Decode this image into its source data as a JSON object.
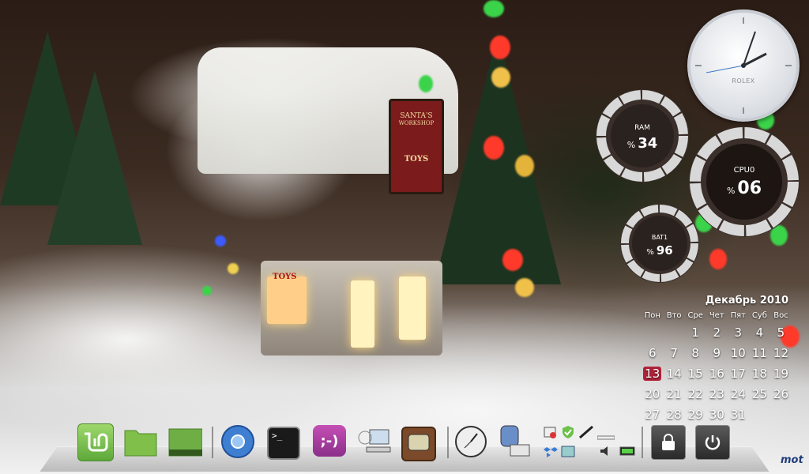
{
  "wallpaper": {
    "sign_line1": "SANTA'S",
    "sign_line2": "WORKSHOP",
    "sign_line3": "TOYS",
    "lower_sign": "TOYS"
  },
  "clock": {
    "brand": "ROLEX"
  },
  "monitors": {
    "ram": {
      "label": "RAM",
      "symbol": "%",
      "value": "34",
      "percent": 34
    },
    "cpu": {
      "label": "CPU0",
      "symbol": "%",
      "value": "06",
      "percent": 6
    },
    "battery": {
      "label": "BAT1",
      "symbol": "%",
      "value": "96",
      "percent": 96
    }
  },
  "calendar": {
    "title": "Декабрь 2010",
    "weekdays": [
      "Пон",
      "Вто",
      "Сре",
      "Чет",
      "Пят",
      "Суб",
      "Вос"
    ],
    "weeks": [
      [
        "",
        "",
        "1",
        "2",
        "3",
        "4",
        "5"
      ],
      [
        "6",
        "7",
        "8",
        "9",
        "10",
        "11",
        "12"
      ],
      [
        "13",
        "14",
        "15",
        "16",
        "17",
        "18",
        "19"
      ],
      [
        "20",
        "21",
        "22",
        "23",
        "24",
        "25",
        "26"
      ],
      [
        "27",
        "28",
        "29",
        "30",
        "31",
        "",
        ""
      ]
    ],
    "today": "13"
  },
  "dock": {
    "items": [
      {
        "name": "mint-menu-icon"
      },
      {
        "name": "folder-icon"
      },
      {
        "name": "folder-desktop-icon"
      },
      {
        "name": "chromium-browser-icon"
      },
      {
        "name": "terminal-icon"
      },
      {
        "name": "pidgin-chat-icon"
      },
      {
        "name": "network-computer-icon"
      },
      {
        "name": "tv-player-icon"
      },
      {
        "name": "clock-app-icon"
      },
      {
        "name": "printer-icon"
      }
    ],
    "terminal_prompt": ">_",
    "chat_face": ";-)"
  },
  "tray": {
    "icons": [
      "update-manager-icon",
      "shield-check-icon",
      "pen-icon",
      "dropbox-icon",
      "window-icon",
      "volume-icon",
      "battery-tray-icon"
    ]
  },
  "system": {
    "lock": "lock-icon",
    "power": "power-icon"
  },
  "watermark": "mot"
}
